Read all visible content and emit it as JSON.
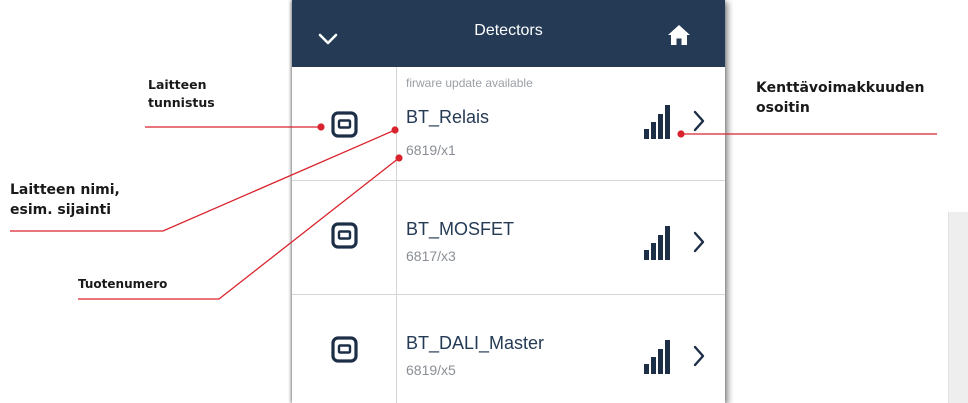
{
  "app": {
    "title": "Detectors",
    "colors": {
      "header": "#243a55",
      "accent": "#243a55",
      "callout": "#d9232d"
    },
    "header_icons": [
      "chevron-down-icon",
      "home-icon"
    ]
  },
  "detectors": [
    {
      "notice": "firware update available",
      "name": "BT_Relais",
      "product": "6819/x1",
      "signal": "strong"
    },
    {
      "notice": "",
      "name": "BT_MOSFET",
      "product": "6817/x3",
      "signal": "strong"
    },
    {
      "notice": "",
      "name": "BT_DALI_Master",
      "product": "6819/x5",
      "signal": "strong"
    }
  ],
  "callouts": {
    "device_id": [
      "Laitteen",
      "tunnistus"
    ],
    "device_name": [
      "Laitteen nimi,",
      "esim. sijainti"
    ],
    "product_number": "Tuotenumero",
    "signal_strength": [
      "Kenttävoimakkuuden",
      "osoitin"
    ]
  }
}
